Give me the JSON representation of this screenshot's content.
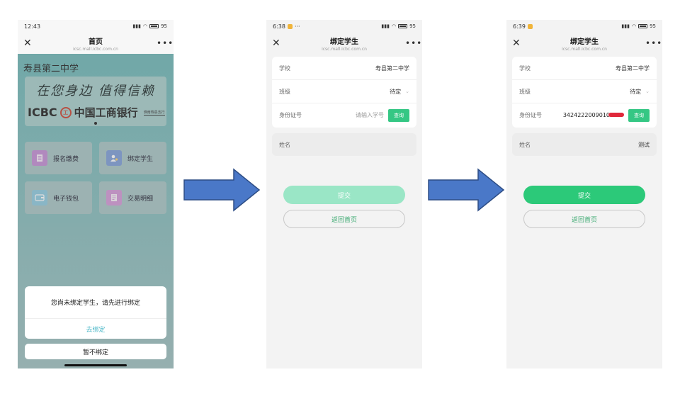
{
  "phone1": {
    "status": {
      "time": "12:43",
      "battery": "95"
    },
    "nav": {
      "title": "首页",
      "subtitle": "icsc.mall.icbc.com.cn"
    },
    "school_heading": "寿县第二中学",
    "banner": {
      "slogan": "在您身边 值得信赖",
      "icbc": "ICBC",
      "bank_name": "中国工商银行",
      "branch": "淮南寿县支行"
    },
    "grid": [
      {
        "label": "报名缴费",
        "icon": "form-icon",
        "color": "#c58fd6"
      },
      {
        "label": "绑定学生",
        "icon": "student-icon",
        "color": "#7f9fd8"
      },
      {
        "label": "电子钱包",
        "icon": "wallet-icon",
        "color": "#8fcbe0"
      },
      {
        "label": "交易明细",
        "icon": "list-icon",
        "color": "#d59ad8"
      }
    ],
    "dialog": {
      "message": "您尚未绑定学生，请先进行绑定",
      "action": "去绑定",
      "later": "暂不绑定"
    }
  },
  "phone2": {
    "status": {
      "time": "6:38",
      "battery": "95"
    },
    "nav": {
      "title": "绑定学生",
      "subtitle": "icsc.mall.icbc.com.cn"
    },
    "form": {
      "school_label": "学校",
      "school_value": "寿县第二中学",
      "class_label": "班级",
      "class_value": "待定",
      "id_label": "身份证号",
      "id_placeholder": "请输入学号",
      "query": "查询"
    },
    "name_label": "姓名",
    "submit": "提交",
    "home": "返回首页"
  },
  "phone3": {
    "status": {
      "time": "6:39",
      "battery": "95"
    },
    "nav": {
      "title": "绑定学生",
      "subtitle": "icsc.mall.icbc.com.cn"
    },
    "form": {
      "school_label": "学校",
      "school_value": "寿县第二中学",
      "class_label": "班级",
      "class_value": "待定",
      "id_label": "身份证号",
      "id_value": "3424222009010",
      "query": "查询"
    },
    "name_label": "姓名",
    "name_value": "测试",
    "submit": "提交",
    "home": "返回首页"
  },
  "colors": {
    "arrow": "#4a78c8",
    "arrow_stroke": "#2e4e86",
    "green": "#2cc979"
  }
}
